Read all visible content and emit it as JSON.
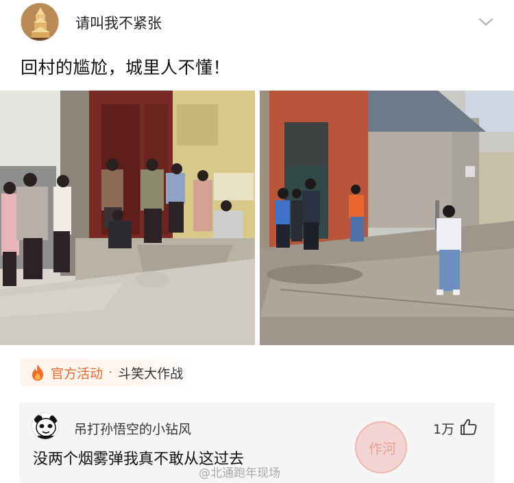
{
  "post": {
    "username": "请叫我不紧张",
    "text": "回村的尴尬，城里人不懂！",
    "images": [
      "village-street-women-photo",
      "village-road-girl-photo"
    ]
  },
  "activity": {
    "official_label": "官方活动",
    "separator": "·",
    "topic": "斗笑大作战"
  },
  "comment": {
    "username": "吊打孙悟空的小钻风",
    "like_count": "1万",
    "text": "没两个烟雾弹我真不敢从这过去"
  },
  "watermark": {
    "stamp_text": "作河",
    "text": "@北通跑年现场"
  },
  "colors": {
    "accent_orange": "#e96a2c",
    "comment_bg": "#f5f5f5"
  },
  "icons": {
    "header_chevron": "chevron-down-icon",
    "activity": "flame-icon",
    "like": "thumbs-up-icon"
  }
}
